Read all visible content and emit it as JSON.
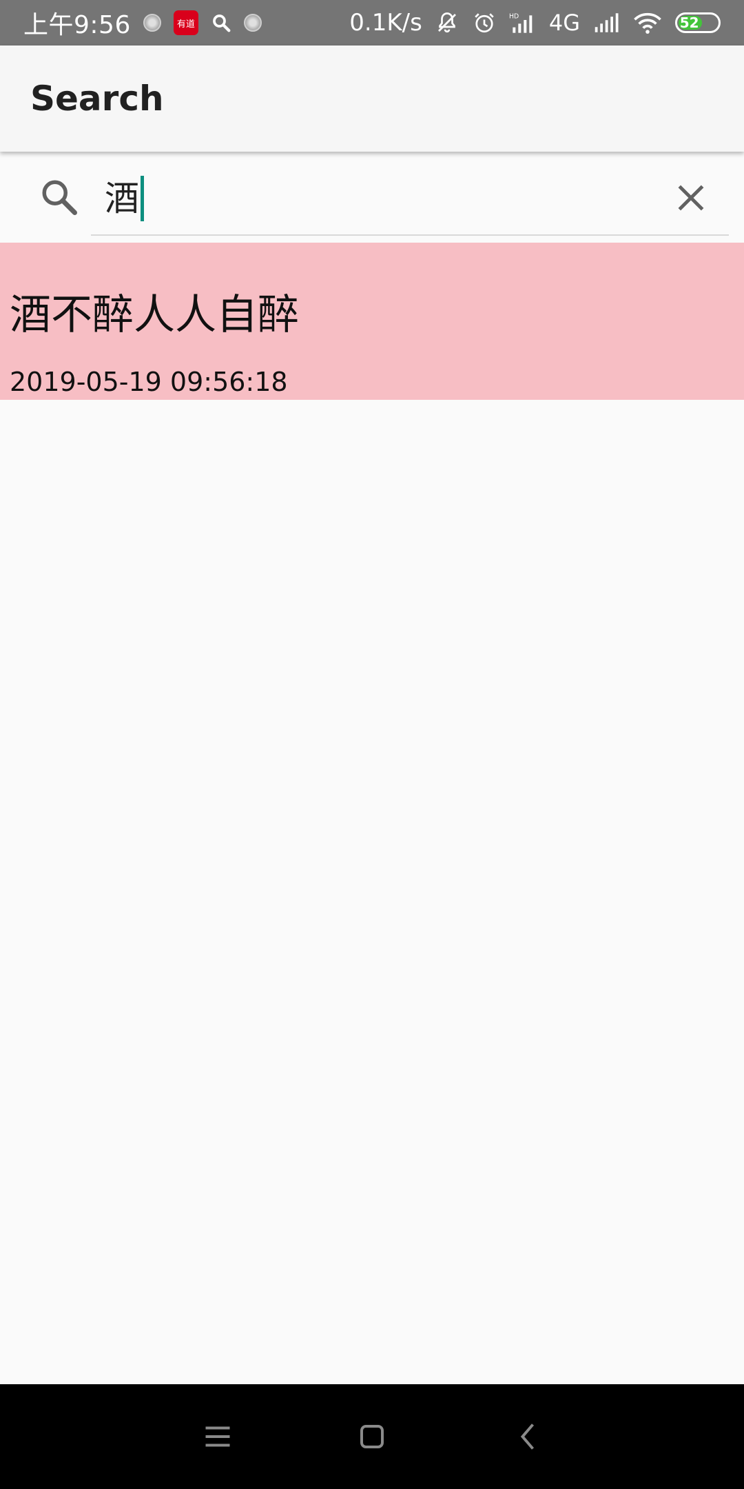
{
  "status_bar": {
    "time": "上午9:56",
    "speed": "0.1K/s",
    "network": "4G",
    "battery": "52",
    "app_icon_text": "有道",
    "battery_color": "#43c43a"
  },
  "app_bar": {
    "title": "Search"
  },
  "search": {
    "query": "酒"
  },
  "results": [
    {
      "title": "酒不醉人人自醉",
      "date": "2019-05-19 09:56:18"
    }
  ],
  "colors": {
    "result_highlight": "#f7bec4",
    "caret": "#0d8f7f",
    "app_bar": "#f6f6f6"
  },
  "icons": {
    "search": "search-icon",
    "clear": "close-icon",
    "nav_menu": "menu-icon",
    "nav_home": "home-icon",
    "nav_back": "back-icon"
  }
}
